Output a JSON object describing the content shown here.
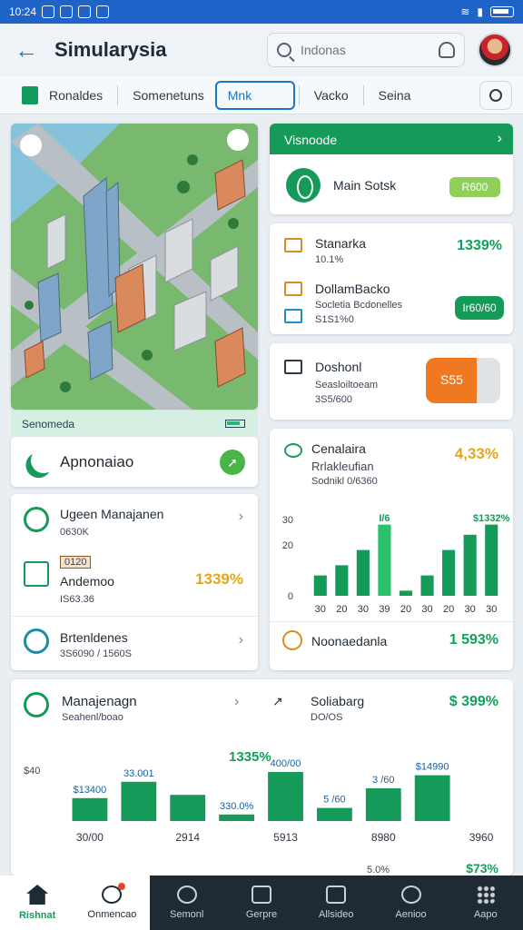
{
  "status": {
    "time": "10:24"
  },
  "app": {
    "title": "Simularysia"
  },
  "search": {
    "placeholder": "Indonas"
  },
  "tabs": [
    "Ronaldes",
    "Somenetuns",
    "Mnk",
    "Vacko",
    "Seina"
  ],
  "map": {
    "caption": "Senomeda"
  },
  "ap_card": {
    "label": "Apnonaiao"
  },
  "list": [
    {
      "title": "Ugeen Manajanen",
      "sub": "0630K",
      "icon": "gear-icon"
    },
    {
      "title": "Andemoo",
      "badge": "0120",
      "sub": "IS63.36",
      "value": "1339%",
      "icon": "document-icon"
    },
    {
      "title": "Brtenldenes",
      "sub": "3S6090 / 1560S",
      "icon": "badge-icon"
    }
  ],
  "green_card": {
    "header": "Visnoode",
    "label": "Main Sotsk",
    "button": "R600"
  },
  "stack_card": [
    {
      "title": "Stanarka",
      "sub": "10.1%",
      "value": "1339%",
      "icon": "edit-icon"
    },
    {
      "title": "DollamBacko",
      "sub": "Socletia Bcdonelles",
      "sub2": "S1S1%0",
      "button": "Ir60/60",
      "icon": "bot-icon"
    }
  ],
  "dash_card": {
    "title": "Doshonl",
    "sub": "Seasloiltoeam",
    "sub2": "3S5/600",
    "pill": "S55",
    "icon": "building-icon"
  },
  "chart_card_1": {
    "title": "Cenalaira",
    "sub": "Rrlakleufian",
    "sub2": "Sodnikl 0/6360",
    "value": "4,33%",
    "footer_title": "Noonaedanla",
    "footer_value": "1 593%"
  },
  "chart_card_2": {
    "title": "Manajenagn",
    "sub": "Seahenl/boao",
    "right_title": "Soliabarg",
    "right_sub": "DO/OS",
    "right_value": "$ 399%",
    "bottom_values": [
      "5.0%",
      "$73%"
    ]
  },
  "chart_data": [
    {
      "type": "bar",
      "categories": [
        "30",
        "20",
        "30",
        "39",
        "20",
        "30",
        "20",
        "30",
        "30"
      ],
      "values": [
        8,
        12,
        18,
        28,
        2,
        8,
        18,
        24,
        28
      ],
      "ylim": [
        0,
        30
      ],
      "yticks": [
        "0",
        "20",
        "30"
      ],
      "annotations": [
        {
          "label": "I/6",
          "at": 3
        },
        {
          "label": "$1332%",
          "at": 8
        }
      ],
      "colors": {
        "bar": "#169a5a",
        "highlight": "#2bc06a"
      }
    },
    {
      "type": "bar",
      "categories": [
        "30/00",
        "",
        "2914",
        "",
        "5913",
        "",
        "8980",
        "",
        "3960"
      ],
      "values": [
        14,
        24,
        16,
        4,
        30,
        8,
        20,
        28,
        0
      ],
      "ylim": [
        0,
        40
      ],
      "data_labels": [
        "$13400",
        "33.001",
        "",
        "330.0%",
        "400/00",
        "5 /60",
        "3 /60",
        "$14990",
        ""
      ],
      "headline": "1335%",
      "yaxis_label": "$40",
      "colors": {
        "bar": "#169a5a"
      }
    }
  ],
  "nav": [
    {
      "label": "Rishnat",
      "icon": "home-icon"
    },
    {
      "label": "Onmencao",
      "icon": "clock-icon"
    },
    {
      "label": "Semonl",
      "icon": "search-icon"
    },
    {
      "label": "Gerpre",
      "icon": "puzzle-icon"
    },
    {
      "label": "Allsideo",
      "icon": "calendar-icon"
    },
    {
      "label": "Aenioo",
      "icon": "search-icon"
    },
    {
      "label": "Aapo",
      "icon": "grid-icon"
    }
  ]
}
